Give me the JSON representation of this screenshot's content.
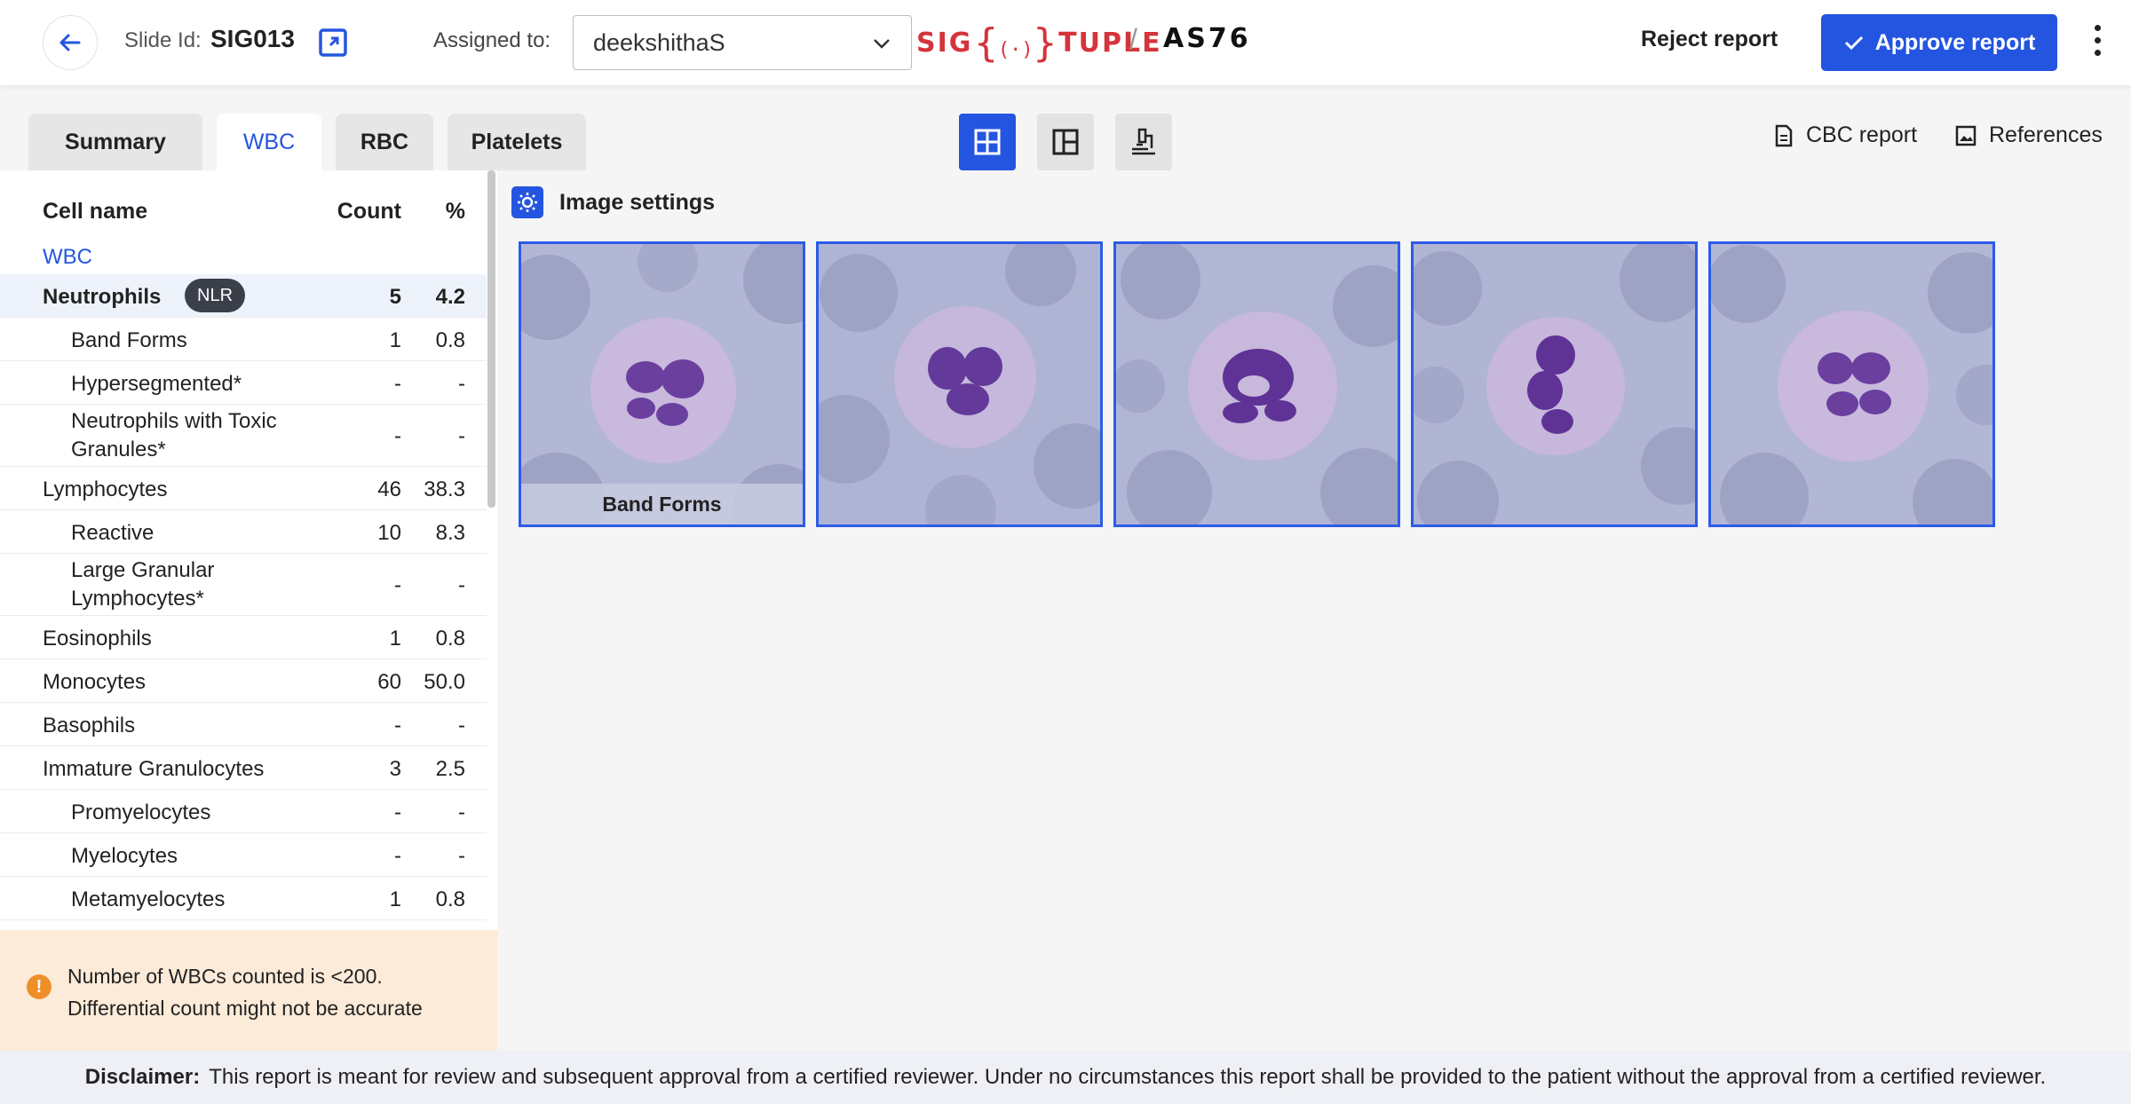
{
  "header": {
    "slide_label": "Slide Id:",
    "slide_id": "SIG013",
    "assigned_label": "Assigned to:",
    "assignee": "deekshithaS",
    "logo_left": "SIG",
    "logo_mid": "(·)",
    "logo_right": "TUPLE",
    "separator": "/",
    "analyzer": "AS76",
    "reject_label": "Reject report",
    "approve_label": "Approve report"
  },
  "tabs": [
    {
      "label": "Summary",
      "active": false
    },
    {
      "label": "WBC",
      "active": true
    },
    {
      "label": "RBC",
      "active": false
    },
    {
      "label": "Platelets",
      "active": false
    }
  ],
  "view_modes": [
    "grid-view-icon",
    "split-view-icon",
    "microscope-icon"
  ],
  "links": {
    "cbc": "CBC report",
    "references": "References"
  },
  "table": {
    "headers": {
      "name": "Cell name",
      "count": "Count",
      "pct": "%"
    },
    "group": "WBC",
    "nlr_badge": "NLR",
    "rows": [
      {
        "name": "Neutrophils",
        "count": "5",
        "pct": "4.2"
      },
      {
        "name": "Band Forms",
        "count": "1",
        "pct": "0.8"
      },
      {
        "name": "Hypersegmented*",
        "count": "-",
        "pct": "-"
      },
      {
        "name": "Neutrophils with Toxic Granules*",
        "count": "-",
        "pct": "-"
      },
      {
        "name": "Lymphocytes",
        "count": "46",
        "pct": "38.3"
      },
      {
        "name": "Reactive",
        "count": "10",
        "pct": "8.3"
      },
      {
        "name": "Large Granular Lymphocytes*",
        "count": "-",
        "pct": "-"
      },
      {
        "name": "Eosinophils",
        "count": "1",
        "pct": "0.8"
      },
      {
        "name": "Monocytes",
        "count": "60",
        "pct": "50.0"
      },
      {
        "name": "Basophils",
        "count": "-",
        "pct": "-"
      },
      {
        "name": "Immature Granulocytes",
        "count": "3",
        "pct": "2.5"
      },
      {
        "name": "Promyelocytes",
        "count": "-",
        "pct": "-"
      },
      {
        "name": "Myelocytes",
        "count": "-",
        "pct": "-"
      },
      {
        "name": "Metamyelocytes",
        "count": "1",
        "pct": "0.8"
      }
    ]
  },
  "warning": {
    "line1": "Number of WBCs counted is <200.",
    "line2": "Differential count might not be accurate"
  },
  "image_settings_label": "Image settings",
  "thumbnails": [
    {
      "caption": "Band Forms"
    },
    {
      "caption": ""
    },
    {
      "caption": ""
    },
    {
      "caption": ""
    },
    {
      "caption": ""
    }
  ],
  "disclaimer": {
    "label": "Disclaimer:",
    "text": "This report is meant for review and subsequent approval from a certified reviewer. Under no circumstances this report shall be provided to the patient without the approval from a certified reviewer."
  },
  "colors": {
    "accent": "#2455e0",
    "warning_bg": "#fcebd8",
    "warning_icon": "#ef8f2a",
    "logo_red": "#d4343b"
  }
}
